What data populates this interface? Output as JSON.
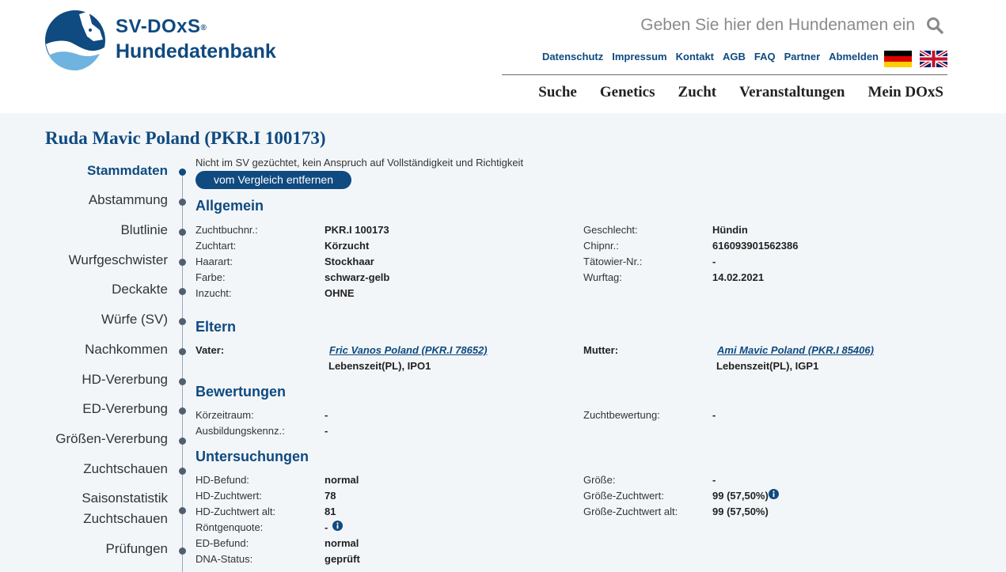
{
  "header": {
    "brand_line1": "SV-DOxS",
    "brand_reg": "®",
    "brand_line2": "Hundedatenbank",
    "search_placeholder": "Geben Sie hier den Hundenamen ein",
    "links": [
      "Datenschutz",
      "Impressum",
      "Kontakt",
      "AGB",
      "FAQ",
      "Partner",
      "Abmelden"
    ],
    "nav": [
      "Suche",
      "Genetics",
      "Zucht",
      "Veranstaltungen",
      "Mein DOxS"
    ],
    "colors": {
      "brand": "#0f4a80"
    }
  },
  "page_title": "Ruda Mavic Poland (PKR.I 100173)",
  "sidenav": [
    "Stammdaten",
    "Abstammung",
    "Blutlinie",
    "Wurfgeschwister",
    "Deckakte",
    "Würfe (SV)",
    "Nachkommen",
    "HD-Vererbung",
    "ED-Vererbung",
    "Größen-Vererbung",
    "Zuchtschauen",
    "Saisonstatistik",
    "Zuchtschauen",
    "Prüfungen"
  ],
  "notice": "Nicht im SV gezüchtet, kein Anspruch auf Vollständigkeit und Richtigkeit",
  "compare_button": "vom Vergleich entfernen",
  "allgemein": {
    "title": "Allgemein",
    "left": [
      {
        "label": "Zuchtbuchnr.:",
        "value": "PKR.I 100173"
      },
      {
        "label": "Zuchtart:",
        "value": "Körzucht"
      },
      {
        "label": "Haarart:",
        "value": "Stockhaar"
      },
      {
        "label": "Farbe:",
        "value": "schwarz-gelb"
      },
      {
        "label": "Inzucht:",
        "value": "OHNE"
      }
    ],
    "right": [
      {
        "label": "Geschlecht:",
        "value": "Hündin"
      },
      {
        "label": "Chipnr.:",
        "value": "616093901562386"
      },
      {
        "label": "Tätowier-Nr.:",
        "value": "-"
      },
      {
        "label": "Wurftag:",
        "value": "14.02.2021"
      }
    ]
  },
  "eltern": {
    "title": "Eltern",
    "vater_label": "Vater:",
    "vater_name": "Fric Vanos Poland (PKR.I 78652)",
    "vater_info": "Lebenszeit(PL), IPO1",
    "mutter_label": "Mutter:",
    "mutter_name": "Ami Mavic Poland (PKR.I 85406)",
    "mutter_info": "Lebenszeit(PL), IGP1"
  },
  "bewertungen": {
    "title": "Bewertungen",
    "left": [
      {
        "label": "Körzeitraum:",
        "value": "-"
      },
      {
        "label": "Ausbildungskennz.:",
        "value": "-"
      }
    ],
    "right": [
      {
        "label": "Zuchtbewertung:",
        "value": "-"
      }
    ]
  },
  "untersuchungen": {
    "title": "Untersuchungen",
    "left": [
      {
        "label": "HD-Befund:",
        "value": "normal"
      },
      {
        "label": "HD-Zuchtwert:",
        "value": "78"
      },
      {
        "label": "HD-Zuchtwert alt:",
        "value": "81"
      },
      {
        "label": "Röntgenquote:",
        "value": "-"
      },
      {
        "label": "ED-Befund:",
        "value": "normal"
      },
      {
        "label": "DNA-Status:",
        "value": "geprüft"
      }
    ],
    "right": [
      {
        "label": "Größe:",
        "value": "-"
      },
      {
        "label": "Größe-Zuchtwert:",
        "value": "99 (57,50%)"
      },
      {
        "label": "Größe-Zuchtwert alt:",
        "value": "99 (57,50%)"
      }
    ]
  }
}
